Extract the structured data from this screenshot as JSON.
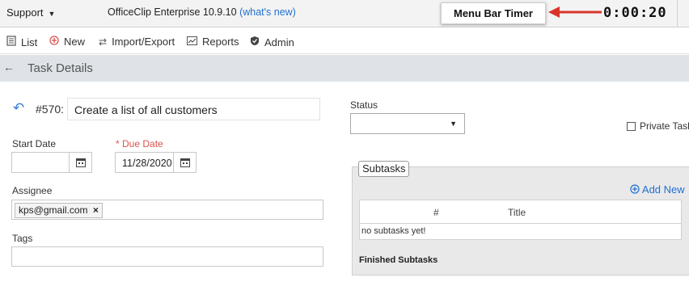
{
  "topbar": {
    "support_label": "Support",
    "app_name": "OfficeClip Enterprise 10.9.10",
    "whats_new": "(what's new)",
    "timer_label": "Menu Bar Timer",
    "timer_value": "0:00:20"
  },
  "toolbar": {
    "items": [
      {
        "label": "List",
        "icon": "list-icon"
      },
      {
        "label": "New",
        "icon": "plus-circle-icon"
      },
      {
        "label": "Import/Export",
        "icon": "swap-icon"
      },
      {
        "label": "Reports",
        "icon": "chart-icon"
      },
      {
        "label": "Admin",
        "icon": "shield-check-icon"
      }
    ]
  },
  "header": {
    "title": "Task Details"
  },
  "task": {
    "number": "#570:",
    "name": "Create a list of all customers"
  },
  "form": {
    "start_date_label": "Start Date",
    "start_date_value": "",
    "due_date_label": "* Due Date",
    "due_date_value": "11/28/2020",
    "assignee_label": "Assignee",
    "assignee_tag": "kps@gmail.com",
    "tags_label": "Tags",
    "status_label": "Status",
    "status_value": "",
    "private_task_label": "Private Task"
  },
  "subtasks": {
    "legend": "Subtasks",
    "add_new": "Add New",
    "columns": [
      "#",
      "Title"
    ],
    "empty_text": "no subtasks yet!",
    "finished_label": "Finished Subtasks"
  },
  "colors": {
    "accent": "#1f6fd1",
    "required": "#d9534f",
    "header_bg": "#dfe3e8",
    "arrow": "#d9342b"
  }
}
